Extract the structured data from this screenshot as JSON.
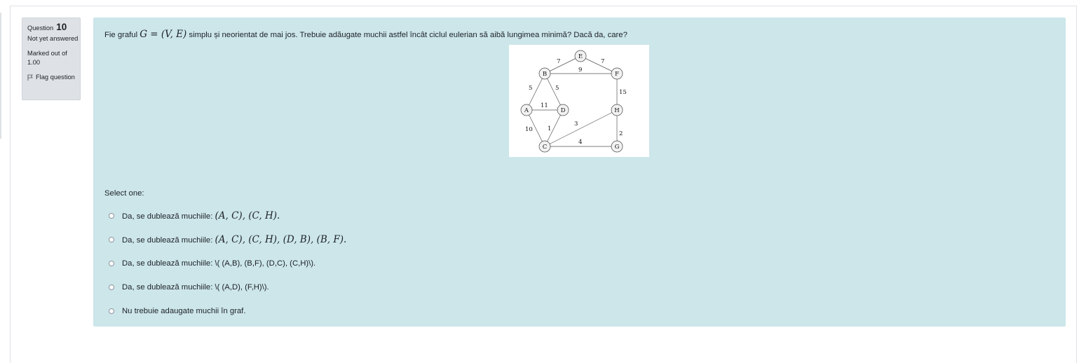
{
  "info": {
    "question_label": "Question",
    "question_number": "10",
    "state": "Not yet answered",
    "grade": "Marked out of 1.00",
    "flag_label": "Flag question"
  },
  "question": {
    "text_before": "Fie graful ",
    "math": "G = (V, E)",
    "text_after": " simplu și neorientat de mai jos. Trebuie adăugate muchii astfel încât ciclul eulerian să aibă lungimea minimă? Dacă da, care?"
  },
  "graph": {
    "nodes": {
      "E": {
        "label": "E"
      },
      "B": {
        "label": "B"
      },
      "F": {
        "label": "F"
      },
      "A": {
        "label": "A"
      },
      "D": {
        "label": "D"
      },
      "H": {
        "label": "H"
      },
      "C": {
        "label": "C"
      },
      "G": {
        "label": "G"
      }
    },
    "edges": [
      {
        "from": "B",
        "to": "E",
        "weight": "7"
      },
      {
        "from": "E",
        "to": "F",
        "weight": "7"
      },
      {
        "from": "B",
        "to": "F",
        "weight": "9"
      },
      {
        "from": "A",
        "to": "B",
        "weight": "5"
      },
      {
        "from": "B",
        "to": "D",
        "weight": "5"
      },
      {
        "from": "F",
        "to": "H",
        "weight": "15"
      },
      {
        "from": "A",
        "to": "D",
        "weight": "11"
      },
      {
        "from": "A",
        "to": "C",
        "weight": "10"
      },
      {
        "from": "D",
        "to": "C",
        "weight": "1"
      },
      {
        "from": "C",
        "to": "H",
        "weight": "3"
      },
      {
        "from": "H",
        "to": "G",
        "weight": "2"
      },
      {
        "from": "C",
        "to": "G",
        "weight": "4"
      }
    ]
  },
  "prompt": "Select one:",
  "answers": [
    {
      "prefix": "Da, se dublează muchiile: ",
      "math": "(A, C), (C, H).",
      "raw": ""
    },
    {
      "prefix": "Da, se dublează muchiile: ",
      "math": "(A, C), (C, H), (D, B), (B, F).",
      "raw": ""
    },
    {
      "prefix": "Da, se dublează muchiile: ",
      "math": "",
      "raw": "\\( (A,B), (B,F), (D,C), (C,H)\\)."
    },
    {
      "prefix": "Da, se dublează muchiile: ",
      "math": "",
      "raw": "\\( (A,D), (F,H)\\)."
    },
    {
      "prefix": "Nu trebuie adaugate muchii în graf.",
      "math": "",
      "raw": ""
    }
  ],
  "colors": {
    "content_bg": "#cce6ea",
    "info_bg": "#dee2e6"
  }
}
